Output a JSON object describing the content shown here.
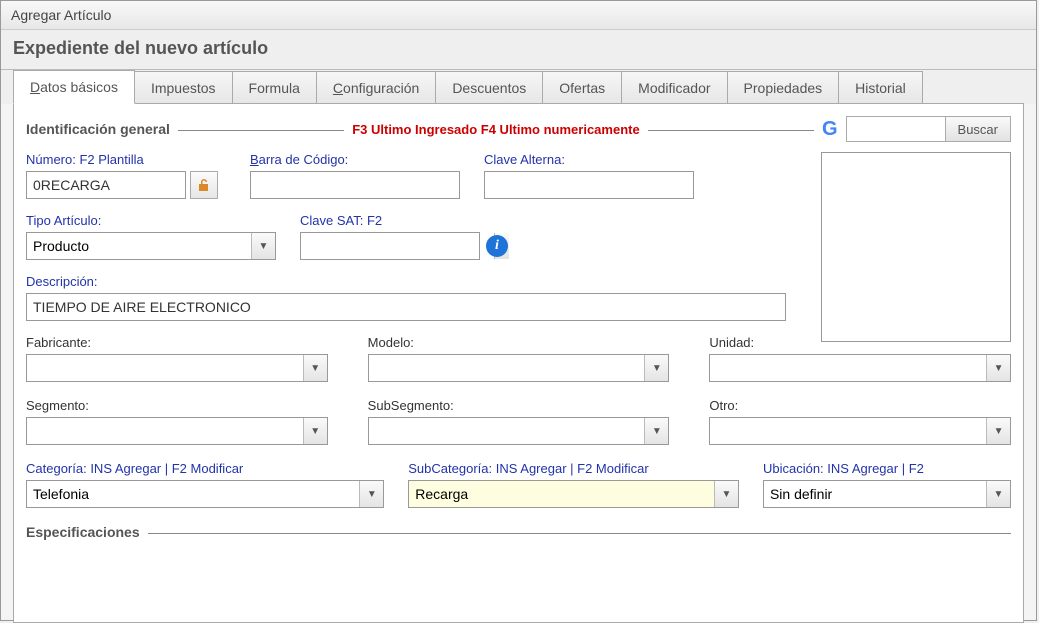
{
  "window": {
    "title": "Agregar Artículo"
  },
  "header": {
    "title": "Expediente del nuevo artículo"
  },
  "tabs": {
    "t0": "Datos básicos",
    "t1": "Impuestos",
    "t2": "Formula",
    "t3": "Configuración",
    "t4": "Descuentos",
    "t5": "Ofertas",
    "t6": "Modificador",
    "t7": "Propiedades",
    "t8": "Historial"
  },
  "section1": {
    "legend": "Identificación general",
    "hint": "F3 Ultimo Ingresado  F4 Ultimo numericamente",
    "search_btn": "Buscar"
  },
  "labels": {
    "numero": "Número: F2 Plantilla",
    "barra": "Barra de Código:",
    "clave_alterna": "Clave Alterna:",
    "tipo": "Tipo Artículo:",
    "clave_sat": "Clave SAT: F2",
    "descripcion": "Descripción:",
    "fabricante": "Fabricante:",
    "modelo": "Modelo:",
    "unidad": "Unidad:",
    "segmento": "Segmento:",
    "subsegmento": "SubSegmento:",
    "otro": "Otro:",
    "categoria": "Categoría:  INS Agregar | F2 Modificar",
    "subcategoria": "SubCategoría: INS Agregar | F2 Modificar",
    "ubicacion": "Ubicación:  INS Agregar | F2"
  },
  "values": {
    "numero": "0RECARGA",
    "barra": "",
    "clave_alterna": "",
    "tipo": "Producto",
    "clave_sat": "",
    "descripcion": "TIEMPO DE AIRE ELECTRONICO",
    "fabricante": "",
    "modelo": "",
    "unidad": "",
    "segmento": "",
    "subsegmento": "",
    "otro": "",
    "categoria": "Telefonia",
    "subcategoria": "Recarga",
    "ubicacion": "Sin definir",
    "search": ""
  },
  "section2": {
    "legend": "Especificaciones"
  }
}
